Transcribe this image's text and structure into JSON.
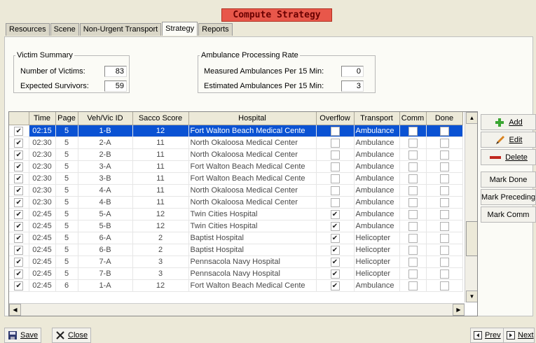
{
  "window_title": "Compute Strategy",
  "tabs": [
    {
      "label": "Resources",
      "active": false
    },
    {
      "label": "Scene",
      "active": false
    },
    {
      "label": "Non-Urgent Transport",
      "active": false
    },
    {
      "label": "Strategy",
      "active": true
    },
    {
      "label": "Reports",
      "active": false
    }
  ],
  "victim_summary": {
    "legend": "Victim Summary",
    "victims_label": "Number of Victims:",
    "victims_value": "83",
    "survivors_label": "Expected Survivors:",
    "survivors_value": "59"
  },
  "ambulance_rate": {
    "legend": "Ambulance Processing Rate",
    "measured_label": "Measured Ambulances Per 15 Min:",
    "measured_value": "0",
    "estimated_label": "Estimated Ambulances Per 15 Min:",
    "estimated_value": "3"
  },
  "table": {
    "columns": [
      "",
      "Time",
      "Page",
      "Veh/Vic ID",
      "Sacco Score",
      "Hospital",
      "Overflow",
      "Transport",
      "Comm",
      "Done"
    ],
    "selected_row": 0,
    "rows": [
      {
        "checked": true,
        "time": "02:15",
        "page": "5",
        "id": "1-B",
        "score": "12",
        "hospital": "Fort Walton Beach Medical Cente",
        "overflow": false,
        "transport": "Ambulance",
        "comm": false,
        "done": false
      },
      {
        "checked": true,
        "time": "02:30",
        "page": "5",
        "id": "2-A",
        "score": "11",
        "hospital": "North Okaloosa Medical Center",
        "overflow": false,
        "transport": "Ambulance",
        "comm": false,
        "done": false
      },
      {
        "checked": true,
        "time": "02:30",
        "page": "5",
        "id": "2-B",
        "score": "11",
        "hospital": "North Okaloosa Medical Center",
        "overflow": false,
        "transport": "Ambulance",
        "comm": false,
        "done": false
      },
      {
        "checked": true,
        "time": "02:30",
        "page": "5",
        "id": "3-A",
        "score": "11",
        "hospital": "Fort Walton Beach Medical Cente",
        "overflow": false,
        "transport": "Ambulance",
        "comm": false,
        "done": false
      },
      {
        "checked": true,
        "time": "02:30",
        "page": "5",
        "id": "3-B",
        "score": "11",
        "hospital": "Fort Walton Beach Medical Cente",
        "overflow": false,
        "transport": "Ambulance",
        "comm": false,
        "done": false
      },
      {
        "checked": true,
        "time": "02:30",
        "page": "5",
        "id": "4-A",
        "score": "11",
        "hospital": "North Okaloosa Medical Center",
        "overflow": false,
        "transport": "Ambulance",
        "comm": false,
        "done": false
      },
      {
        "checked": true,
        "time": "02:30",
        "page": "5",
        "id": "4-B",
        "score": "11",
        "hospital": "North Okaloosa Medical Center",
        "overflow": false,
        "transport": "Ambulance",
        "comm": false,
        "done": false
      },
      {
        "checked": true,
        "time": "02:45",
        "page": "5",
        "id": "5-A",
        "score": "12",
        "hospital": "Twin Cities Hospital",
        "overflow": true,
        "transport": "Ambulance",
        "comm": false,
        "done": false
      },
      {
        "checked": true,
        "time": "02:45",
        "page": "5",
        "id": "5-B",
        "score": "12",
        "hospital": "Twin Cities Hospital",
        "overflow": true,
        "transport": "Ambulance",
        "comm": false,
        "done": false
      },
      {
        "checked": true,
        "time": "02:45",
        "page": "5",
        "id": "6-A",
        "score": "2",
        "hospital": "Baptist Hospital",
        "overflow": true,
        "transport": "Helicopter",
        "comm": false,
        "done": false
      },
      {
        "checked": true,
        "time": "02:45",
        "page": "5",
        "id": "6-B",
        "score": "2",
        "hospital": "Baptist Hospital",
        "overflow": true,
        "transport": "Helicopter",
        "comm": false,
        "done": false
      },
      {
        "checked": true,
        "time": "02:45",
        "page": "5",
        "id": "7-A",
        "score": "3",
        "hospital": "Pennsacola Navy Hospital",
        "overflow": true,
        "transport": "Helicopter",
        "comm": false,
        "done": false
      },
      {
        "checked": true,
        "time": "02:45",
        "page": "5",
        "id": "7-B",
        "score": "3",
        "hospital": "Pennsacola Navy Hospital",
        "overflow": true,
        "transport": "Helicopter",
        "comm": false,
        "done": false
      },
      {
        "checked": true,
        "time": "02:45",
        "page": "6",
        "id": "1-A",
        "score": "12",
        "hospital": "Fort Walton Beach Medical Cente",
        "overflow": true,
        "transport": "Ambulance",
        "comm": false,
        "done": false
      }
    ]
  },
  "side_buttons": {
    "add": "Add",
    "edit": "Edit",
    "delete": "Delete",
    "mark_done": "Mark Done",
    "mark_preceding": "Mark Preceding",
    "mark_comm": "Mark Comm"
  },
  "bottom": {
    "save": "Save",
    "close": "Close",
    "prev": "Prev",
    "next": "Next"
  },
  "colors": {
    "title_bg": "#e8574a",
    "selection": "#0a52d3",
    "add_icon": "#3aa632",
    "delete_icon": "#c0281e",
    "edit_icon": "#d9821e"
  }
}
